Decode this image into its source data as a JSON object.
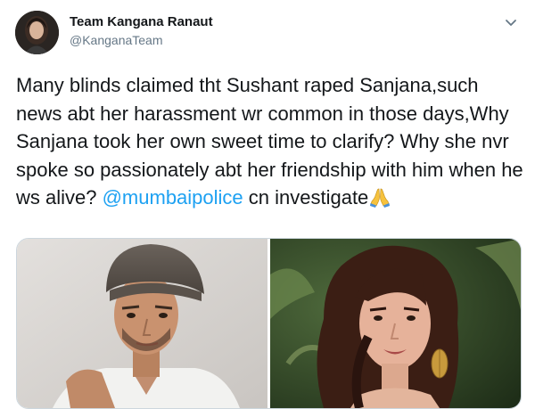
{
  "author": {
    "name": "Team Kangana Ranaut",
    "handle": "@KanganaTeam"
  },
  "tweet": {
    "text_before_mention": "Many blinds claimed tht Sushant raped Sanjana,such news abt her harassment wr common in those days,Why Sanjana took her own sweet time to clarify? Why she nvr spoke so passionately abt her friendship with him when he ws alive? ",
    "mention": "@mumbaipolice",
    "text_after_mention": " cn investigate"
  },
  "icons": {
    "menu": "chevron-down-icon",
    "emoji": "folded-hands-icon"
  },
  "colors": {
    "text": "#14171a",
    "muted": "#657786",
    "link": "#1da1f2",
    "border": "#ccd6dd"
  }
}
